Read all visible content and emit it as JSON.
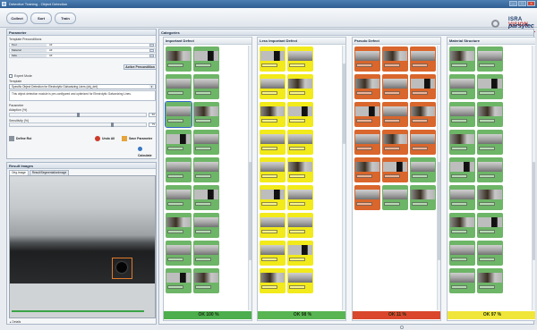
{
  "window": {
    "title": "Detective Training - Object Detection"
  },
  "toolbar": {
    "buttons": [
      "Collect",
      "Sort",
      "Train"
    ]
  },
  "logo": {
    "line1_a": "ISRA ",
    "line1_b": "VISION",
    "line2": "parsytec"
  },
  "parameter": {
    "title": "Parameter",
    "template_preconditions_label": "Template Preconditions",
    "preconditions": [
      {
        "key": "Tool",
        "value": "All"
      },
      {
        "key": "Material",
        "value": "All"
      },
      {
        "key": "Side",
        "value": "All"
      }
    ],
    "active_preconditions_label": "Active Precondition",
    "expert_mode_label": "Expert Mode",
    "template_label": "Template",
    "template_value": "Specific Object Detection for Electrolytic Galvanizing Lines (obj_det)",
    "description": "This object detection module is pre-configured and optimized for Electrolytic Galvanizing Lines.",
    "parameter_label": "Parameter",
    "adaption_label": "Adaption (%)",
    "adaption_value": "60",
    "adaption_level": 0.5,
    "sensitivity_label": "Sensitivity (%)",
    "sensitivity_value": "75",
    "sensitivity_level": 0.75,
    "define_roi_label": "Define Roi",
    "undo_all_label": "Undo All",
    "save_parameter_label": "Save Parameter",
    "calculate_label": "Calculate"
  },
  "result": {
    "title": "Result Images",
    "tabs": [
      "Orig.Image",
      "Result/SegmentationImage"
    ],
    "details_label": "Details"
  },
  "categories": {
    "title": "Categories",
    "columns": [
      {
        "name": "Important Defect",
        "tile_color": "#6db567",
        "status": "OK 100 %",
        "status_color": "#4cae4c"
      },
      {
        "name": "Less Important Defect",
        "tile_color": "#f2ea1a",
        "status": "OK 98 %",
        "status_color": "#58b552"
      },
      {
        "name": "Pseudo Defect",
        "tile_color": "#d9662c",
        "status": "OK 11 %",
        "status_color": "#d9462c"
      },
      {
        "name": "Material Structure",
        "tile_color": "#6db567",
        "status": "OK 97 %",
        "status_color": "#f0e63a"
      }
    ]
  },
  "colors": {
    "accent": "#2f68c7",
    "titlebar": "#3d6ea3"
  }
}
